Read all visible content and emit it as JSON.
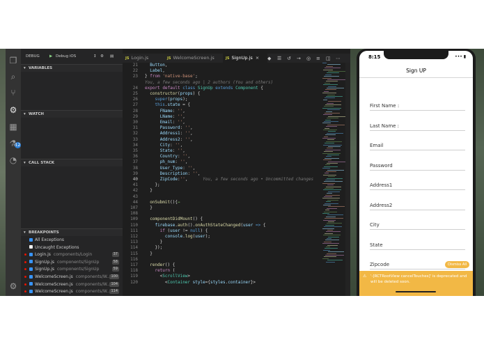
{
  "debug": {
    "label": "DEBUG",
    "config": "Debug iOS"
  },
  "sections": {
    "variables": "VARIABLES",
    "watch": "WATCH",
    "call_stack": "CALL STACK",
    "breakpoints": "BREAKPOINTS"
  },
  "breakpoints": [
    {
      "name": "All Exceptions",
      "path": "",
      "line": "",
      "checked": true,
      "dot": false
    },
    {
      "name": "Uncaught Exceptions",
      "path": "",
      "line": "",
      "checked": false,
      "dot": false
    },
    {
      "name": "Login.js",
      "path": "components/Login",
      "line": "37",
      "checked": true,
      "dot": true
    },
    {
      "name": "SignUp.js",
      "path": "components/SignUp",
      "line": "58",
      "checked": true,
      "dot": true
    },
    {
      "name": "SignUp.js",
      "path": "components/SignUp",
      "line": "59",
      "checked": true,
      "dot": true
    },
    {
      "name": "WelcomeScreen.js",
      "path": "components/W...",
      "line": "100",
      "checked": true,
      "dot": true
    },
    {
      "name": "WelcomeScreen.js",
      "path": "components/W...",
      "line": "104",
      "checked": true,
      "dot": true
    },
    {
      "name": "WelcomeScreen.js",
      "path": "components/W...",
      "line": "114",
      "checked": true,
      "dot": true
    }
  ],
  "tabs": [
    {
      "name": "Login.js",
      "active": false
    },
    {
      "name": "WelcomeScreen.js",
      "active": false
    },
    {
      "name": "SignUp.js",
      "active": true
    }
  ],
  "code": {
    "line_numbers": [
      "21",
      "22",
      "23",
      "",
      "24",
      "25",
      "26",
      "27",
      "28",
      "29",
      "30",
      "31",
      "32",
      "33",
      "34",
      "35",
      "36",
      "37",
      "38",
      "39",
      "40",
      "41",
      "42",
      "43",
      "44",
      "107",
      "108",
      "109",
      "110",
      "111",
      "112",
      "113",
      "114",
      "115",
      "116",
      "117",
      "118",
      "119",
      "120"
    ],
    "blame_header": "You, a few seconds ago | 2 authors (You and others)",
    "inline_blame": "You, a few seconds ago • Uncommitted changes"
  },
  "phone": {
    "time": "8:15",
    "title": "Sign UP",
    "fields": [
      "First Name :",
      "Last Name :",
      "Email",
      "Password",
      "Address1",
      "Address2",
      "City",
      "State",
      "Zipcode"
    ],
    "dismiss": "Dismiss All",
    "warning": "'-[RCTRootView cancelTouches]' is deprecated and will be deleted soon."
  }
}
